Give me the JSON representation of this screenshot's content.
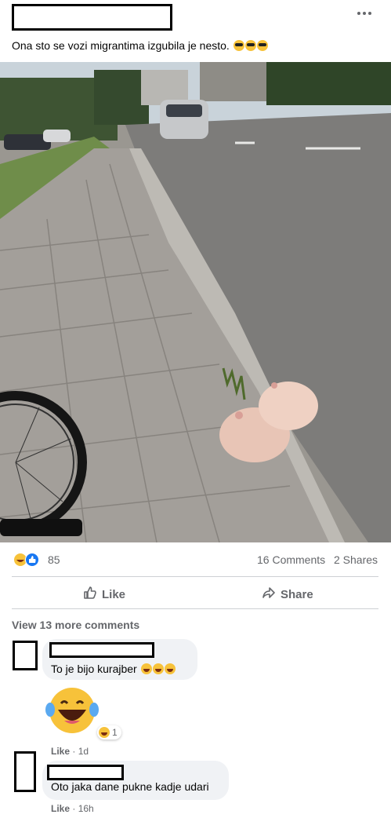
{
  "post": {
    "text": "Ona sto se vozi migrantima izgubila je nesto.",
    "more_icon": "more-horizontal-icon"
  },
  "stats": {
    "reaction_count": "85",
    "comments": "16 Comments",
    "shares": "2 Shares"
  },
  "actions": {
    "like": "Like",
    "share": "Share"
  },
  "comments_section": {
    "view_more": "View 13 more comments",
    "comments": [
      {
        "text": "To je bijo kurajber"
      },
      {
        "reaction_count": "1",
        "meta_like": "Like",
        "meta_time": "1d"
      },
      {
        "text": "Oto jaka dane pukne kadje udari",
        "meta_like": "Like",
        "meta_time": "16h"
      }
    ]
  },
  "colors": {
    "secondary_text": "#65676b",
    "bubble": "#f0f2f5",
    "like_blue": "#1877f2",
    "haha_yellow": "#f7c23a"
  }
}
